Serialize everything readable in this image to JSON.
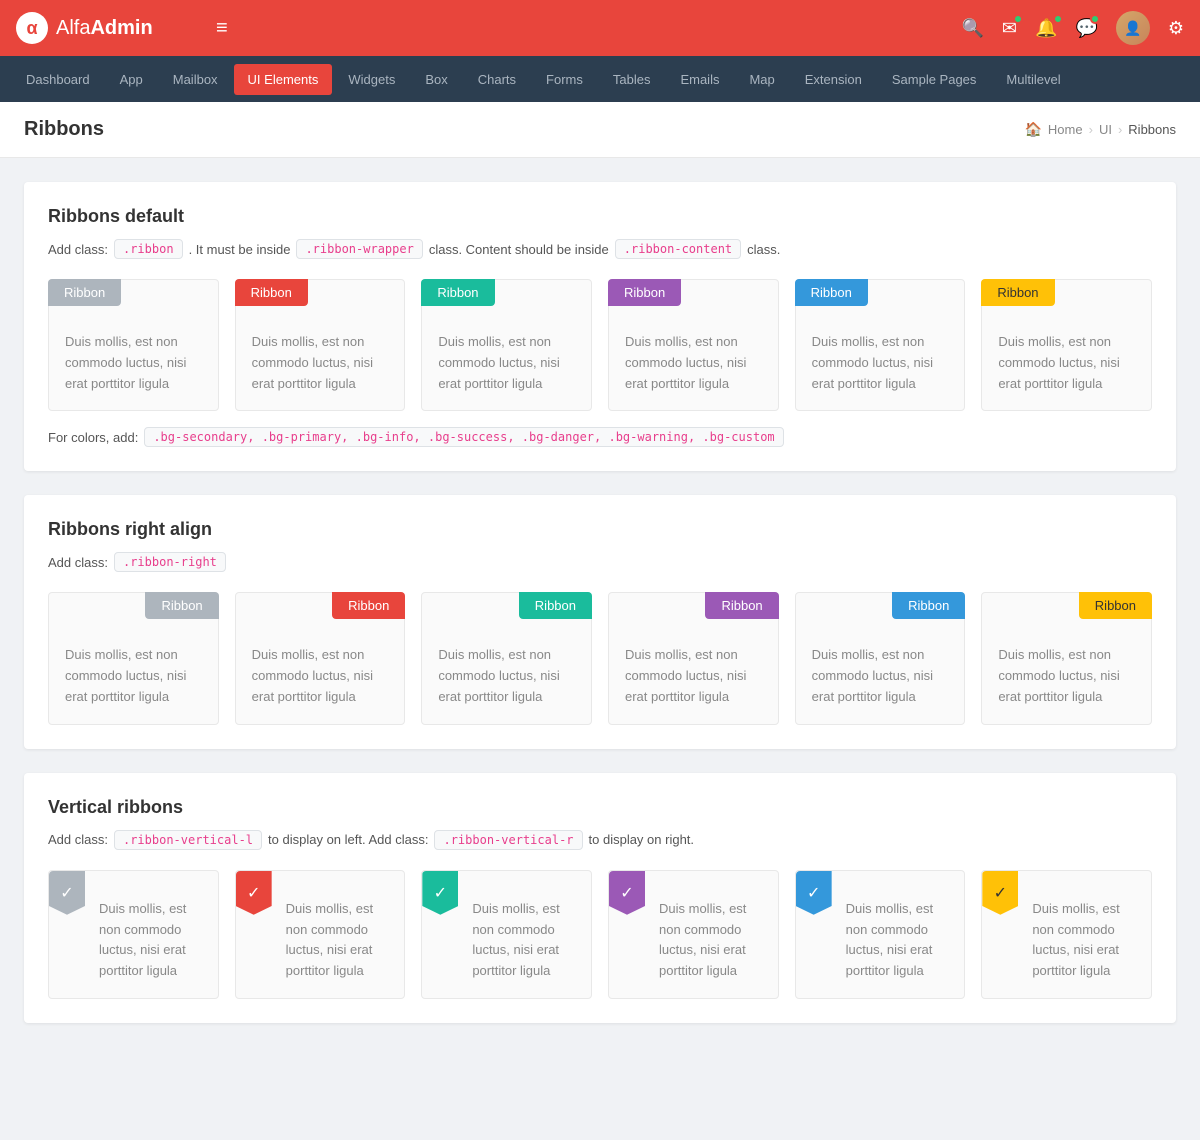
{
  "topbar": {
    "logo_alfa": "Alfa",
    "logo_admin": "Admin",
    "hamburger": "≡"
  },
  "nav": {
    "items": [
      {
        "label": "Dashboard",
        "active": false
      },
      {
        "label": "App",
        "active": false
      },
      {
        "label": "Mailbox",
        "active": false
      },
      {
        "label": "UI Elements",
        "active": true
      },
      {
        "label": "Widgets",
        "active": false
      },
      {
        "label": "Box",
        "active": false
      },
      {
        "label": "Charts",
        "active": false
      },
      {
        "label": "Forms",
        "active": false
      },
      {
        "label": "Tables",
        "active": false
      },
      {
        "label": "Emails",
        "active": false
      },
      {
        "label": "Map",
        "active": false
      },
      {
        "label": "Extension",
        "active": false
      },
      {
        "label": "Sample Pages",
        "active": false
      },
      {
        "label": "Multilevel",
        "active": false
      }
    ]
  },
  "page": {
    "title": "Ribbons",
    "breadcrumb_home": "Home",
    "breadcrumb_ui": "UI",
    "breadcrumb_current": "Ribbons"
  },
  "sections": {
    "default": {
      "title": "Ribbons default",
      "desc_prefix": "Add class:",
      "class1": ".ribbon",
      "desc_mid": ". It must be inside",
      "class2": ".ribbon-wrapper",
      "desc_mid2": "class. Content should be inside",
      "class3": ".ribbon-content",
      "desc_suffix": "class.",
      "color_note": "For colors, add:",
      "color_classes": ".bg-secondary, .bg-primary, .bg-info, .bg-success, .bg-danger, .bg-warning, .bg-custom",
      "ribbon_label": "Ribbon",
      "card_text": "Duis mollis, est non commodo luctus, nisi erat porttitor ligula",
      "ribbons": [
        {
          "color": "bg-secondary",
          "label": "Ribbon"
        },
        {
          "color": "bg-primary",
          "label": "Ribbon"
        },
        {
          "color": "bg-teal",
          "label": "Ribbon"
        },
        {
          "color": "bg-custom",
          "label": "Ribbon"
        },
        {
          "color": "bg-blue",
          "label": "Ribbon"
        },
        {
          "color": "bg-warning",
          "label": "Ribbon"
        }
      ]
    },
    "right": {
      "title": "Ribbons right align",
      "desc_prefix": "Add class:",
      "class1": ".ribbon-right",
      "ribbons": [
        {
          "color": "bg-secondary",
          "label": "Ribbon"
        },
        {
          "color": "bg-primary",
          "label": "Ribbon"
        },
        {
          "color": "bg-teal",
          "label": "Ribbon"
        },
        {
          "color": "bg-custom",
          "label": "Ribbon"
        },
        {
          "color": "bg-blue",
          "label": "Ribbon"
        },
        {
          "color": "bg-warning",
          "label": "Ribbon"
        }
      ],
      "card_text": "Duis mollis, est non commodo luctus, nisi erat porttitor ligula"
    },
    "vertical": {
      "title": "Vertical ribbons",
      "desc_prefix": "Add class:",
      "class1": ".ribbon-vertical-l",
      "desc_mid": "to display on left. Add class:",
      "class2": ".ribbon-vertical-r",
      "desc_suffix": "to display on right.",
      "ribbons": [
        {
          "color": "bg-secondary",
          "icon": "✓"
        },
        {
          "color": "bg-primary",
          "icon": "✓"
        },
        {
          "color": "bg-teal",
          "icon": "✓"
        },
        {
          "color": "bg-custom",
          "icon": "✓"
        },
        {
          "color": "bg-blue",
          "icon": "✓"
        },
        {
          "color": "bg-warning",
          "icon": "✓"
        }
      ],
      "card_text": "Duis mollis, est non commodo luctus, nisi erat porttitor ligula"
    }
  }
}
